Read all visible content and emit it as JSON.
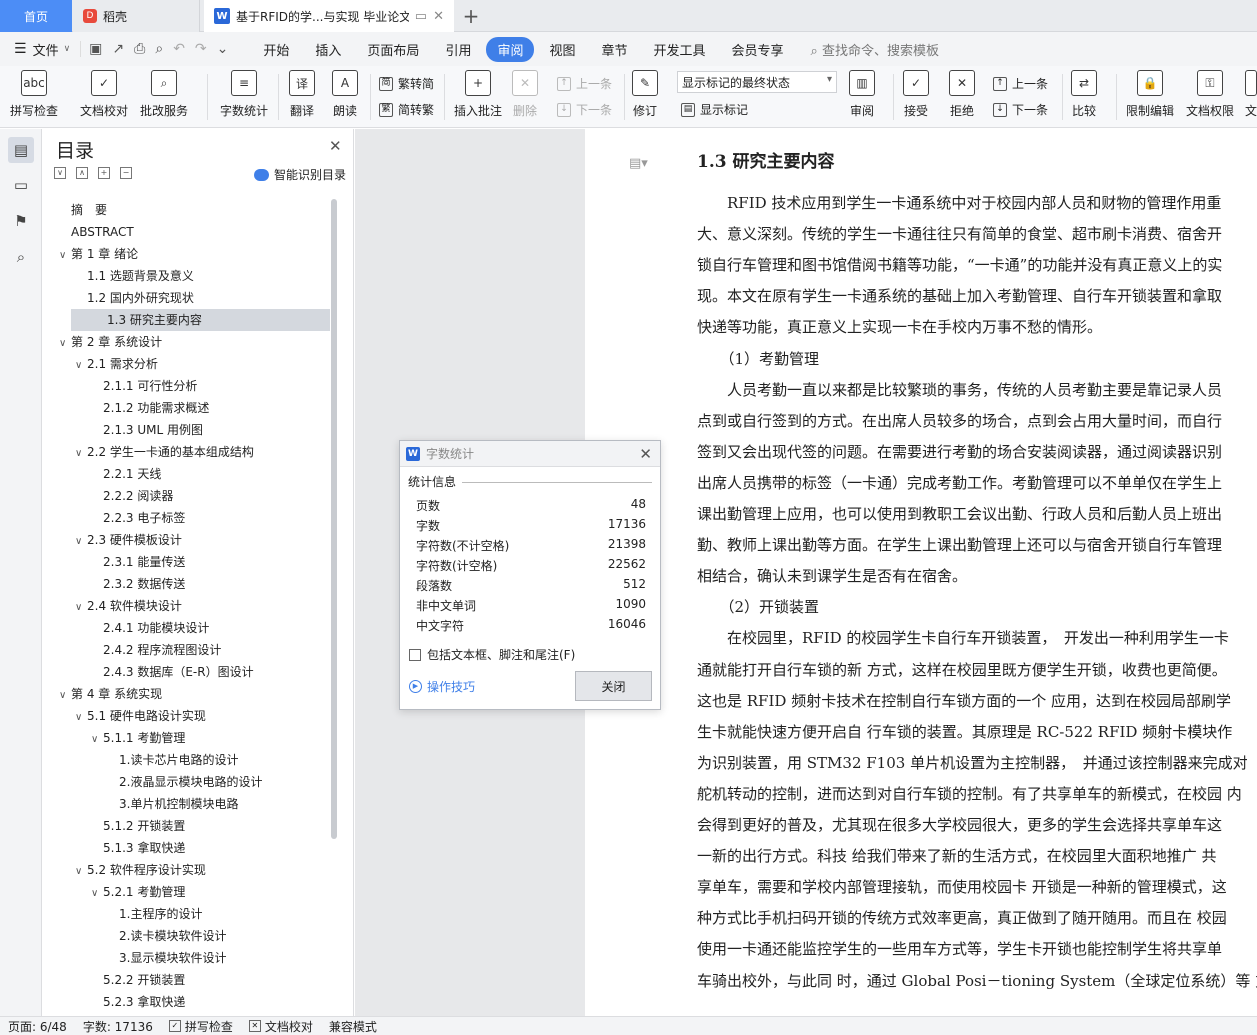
{
  "tabs": {
    "home": "首页",
    "daoke": "稻壳",
    "doc_title": "基于RFID的学...与实现 毕业论文"
  },
  "menu": {
    "file": "文件",
    "tabs": [
      "开始",
      "插入",
      "页面布局",
      "引用",
      "审阅",
      "视图",
      "章节",
      "开发工具",
      "会员专享"
    ],
    "active_tab": "审阅",
    "search_placeholder": "查找命令、搜索模板"
  },
  "ribbon": {
    "spell_check": "拼写检查",
    "doc_proof": "文档校对",
    "annotate_service": "批改服务",
    "word_count": "字数统计",
    "translate": "翻译",
    "read_aloud": "朗读",
    "trad_to_simp": "繁转简",
    "simp_to_trad": "简转繁",
    "insert_comment": "插入批注",
    "delete": "删除",
    "prev_comment": "上一条",
    "next_comment": "下一条",
    "track_changes": "修订",
    "markup_mode": "显示标记的最终状态",
    "show_markup": "显示标记",
    "review": "审阅",
    "accept": "接受",
    "reject": "拒绝",
    "prev_change": "上一条",
    "next_change": "下一条",
    "compare": "比较",
    "restrict_edit": "限制编辑",
    "doc_permission": "文档权限",
    "more": "文"
  },
  "toc": {
    "title": "目录",
    "smart_label": "智能识别目录",
    "items": [
      {
        "text": "摘　要",
        "level": 0,
        "chev": ""
      },
      {
        "text": "ABSTRACT",
        "level": 0,
        "chev": ""
      },
      {
        "text": "第 1 章  绪论",
        "level": 0,
        "chev": "v"
      },
      {
        "text": "1.1 选题背景及意义",
        "level": 1,
        "chev": ""
      },
      {
        "text": "1.2 国内外研究现状",
        "level": 1,
        "chev": ""
      },
      {
        "text": "1.3 研究主要内容",
        "level": 1,
        "chev": "",
        "selected": true
      },
      {
        "text": "第 2 章  系统设计",
        "level": 0,
        "chev": "v"
      },
      {
        "text": "2.1 需求分析",
        "level": 1,
        "chev": "v"
      },
      {
        "text": "2.1.1 可行性分析",
        "level": 2,
        "chev": ""
      },
      {
        "text": "2.1.2 功能需求概述",
        "level": 2,
        "chev": ""
      },
      {
        "text": "2.1.3 UML 用例图",
        "level": 2,
        "chev": ""
      },
      {
        "text": "2.2 学生一卡通的基本组成结构",
        "level": 1,
        "chev": "v"
      },
      {
        "text": "2.2.1 天线",
        "level": 2,
        "chev": ""
      },
      {
        "text": "2.2.2 阅读器",
        "level": 2,
        "chev": ""
      },
      {
        "text": "2.2.3 电子标签",
        "level": 2,
        "chev": ""
      },
      {
        "text": "2.3 硬件模板设计",
        "level": 1,
        "chev": "v"
      },
      {
        "text": "2.3.1 能量传送",
        "level": 2,
        "chev": ""
      },
      {
        "text": "2.3.2 数据传送",
        "level": 2,
        "chev": ""
      },
      {
        "text": "2.4 软件模块设计",
        "level": 1,
        "chev": "v"
      },
      {
        "text": "2.4.1 功能模块设计",
        "level": 2,
        "chev": ""
      },
      {
        "text": "2.4.2 程序流程图设计",
        "level": 2,
        "chev": ""
      },
      {
        "text": "2.4.3 数据库（E-R）图设计",
        "level": 2,
        "chev": ""
      },
      {
        "text": "第 4 章  系统实现",
        "level": 0,
        "chev": "v"
      },
      {
        "text": "5.1 硬件电路设计实现",
        "level": 1,
        "chev": "v"
      },
      {
        "text": "5.1.1 考勤管理",
        "level": 2,
        "chev": "v"
      },
      {
        "text": "1.读卡芯片电路的设计",
        "level": 3,
        "chev": ""
      },
      {
        "text": "2.液晶显示模块电路的设计",
        "level": 3,
        "chev": ""
      },
      {
        "text": "3.单片机控制模块电路",
        "level": 3,
        "chev": ""
      },
      {
        "text": "5.1.2 开锁装置",
        "level": 2,
        "chev": ""
      },
      {
        "text": "5.1.3 拿取快递",
        "level": 2,
        "chev": ""
      },
      {
        "text": "5.2 软件程序设计实现",
        "level": 1,
        "chev": "v"
      },
      {
        "text": "5.2.1 考勤管理",
        "level": 2,
        "chev": "v"
      },
      {
        "text": "1.主程序的设计",
        "level": 3,
        "chev": ""
      },
      {
        "text": "2.读卡模块软件设计",
        "level": 3,
        "chev": ""
      },
      {
        "text": "3.显示模块软件设计",
        "level": 3,
        "chev": ""
      },
      {
        "text": "5.2.2 开锁装置",
        "level": 2,
        "chev": ""
      },
      {
        "text": "5.2.3 拿取快递",
        "level": 2,
        "chev": ""
      }
    ]
  },
  "dialog": {
    "title": "字数统计",
    "group_label": "统计信息",
    "rows": [
      {
        "label": "页数",
        "value": "48"
      },
      {
        "label": "字数",
        "value": "17136"
      },
      {
        "label": "字符数(不计空格)",
        "value": "21398"
      },
      {
        "label": "字符数(计空格)",
        "value": "22562"
      },
      {
        "label": "段落数",
        "value": "512"
      },
      {
        "label": "非中文单词",
        "value": "1090"
      },
      {
        "label": "中文字符",
        "value": "16046"
      }
    ],
    "checkbox_label": "包括文本框、脚注和尾注(F)",
    "tips": "操作技巧",
    "close_button": "关闭"
  },
  "document": {
    "heading": "1.3 研究主要内容",
    "lines": [
      "　　RFID 技术应用到学生一卡通系统中对于校园内部人员和财物的管理作用重",
      "大、意义深刻。传统的学生一卡通往往只有简单的食堂、超市刷卡消费、宿舍开",
      "锁自行车管理和图书馆借阅书籍等功能，“一卡通”的功能并没有真正意义上的实",
      "现。本文在原有学生一卡通系统的基础上加入考勤管理、自行车开锁装置和拿取",
      "快递等功能，真正意义上实现一卡在手校内万事不愁的情形。",
      "　　（1）考勤管理",
      "　　人员考勤一直以来都是比较繁琐的事务，传统的人员考勤主要是靠记录人员",
      "点到或自行签到的方式。在出席人员较多的场合，点到会占用大量时间，而自行",
      "签到又会出现代签的问题。在需要进行考勤的场合安装阅读器，通过阅读器识别",
      "出席人员携带的标签（一卡通）完成考勤工作。考勤管理可以不单单仅在学生上",
      "课出勤管理上应用，也可以使用到教职工会议出勤、行政人员和后勤人员上班出",
      "勤、教师上课出勤等方面。在学生上课出勤管理上还可以与宿舍开锁自行车管理",
      "相结合，确认未到课学生是否有在宿舍。",
      "　　（2）开锁装置",
      "　　在校园里，RFID 的校园学生卡自行车开锁装置，　开发出一种利用学生一卡",
      "通就能打开自行车锁的新 方式，这样在校园里既方便学生开锁，收费也更简便。",
      "这也是 RFID 频射卡技术在控制自行车锁方面的一个 应用，达到在校园局部刷学",
      "生卡就能快速方便开启自 行车锁的装置。其原理是 RC-522 RFID 频射卡模块作",
      "为识别装置，用 STM32 F103 单片机设置为主控制器，　并通过该控制器来完成对",
      "舵机转动的控制，进而达到对自行车锁的控制。有了共享单车的新模式，在校园 内",
      "会得到更好的普及，尤其现在很多大学校园很大，更多的学生会选择共享单车这",
      "一新的出行方式。科技 给我们带来了新的生活方式，在校园里大面积地推广 共",
      "享单车，需要和学校内部管理接轨，而使用校园卡 开锁是一种新的管理模式，这",
      "种方式比手机扫码开锁的传统方式效率更高，真正做到了随开随用。而且在 校园",
      "使用一卡通还能监控学生的一些用车方式等，学生卡开锁也能控制学生将共享单",
      "车骑出校外，与此同 时，通过 Global Posi－tioning System（全球定位系统）等 方"
    ]
  },
  "status": {
    "page": "页面: 6/48",
    "words": "字数: 17136",
    "spell": "拼写检查",
    "proof": "文档校对",
    "compat": "兼容模式"
  }
}
